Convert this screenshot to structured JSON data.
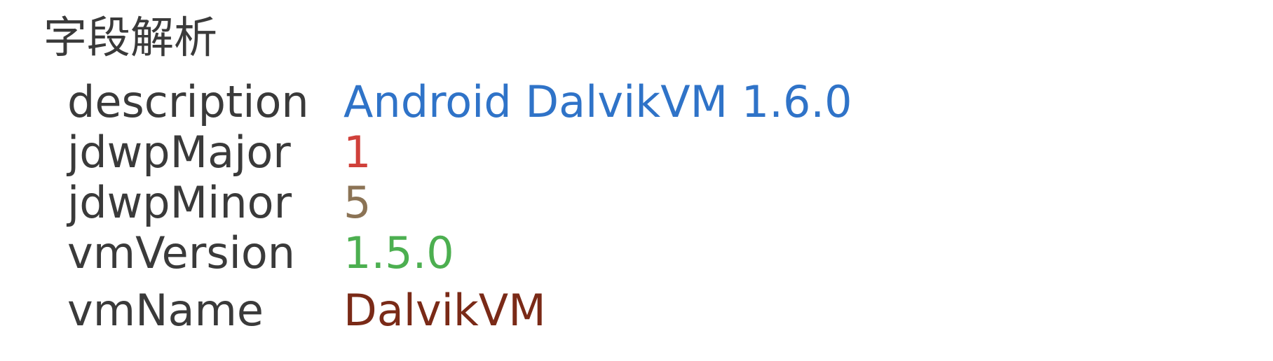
{
  "title": "字段解析",
  "fields": [
    {
      "key": "description",
      "value": "Android DalvikVM 1.6.0",
      "color": "#2f73c8"
    },
    {
      "key": "jdwpMajor",
      "value": "1",
      "color": "#d0403a"
    },
    {
      "key": "jdwpMinor",
      "value": "5",
      "color": "#8b7355"
    },
    {
      "key": "vmVersion",
      "value": "1.5.0",
      "color": "#4caf50"
    },
    {
      "key": "vmName",
      "value": "DalvikVM",
      "color": "#7a2a17"
    }
  ]
}
